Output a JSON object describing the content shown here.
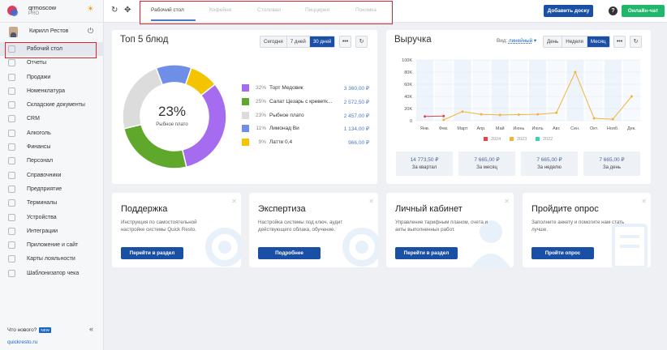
{
  "brand": {
    "name": "qrmoscow",
    "tier": "PRO"
  },
  "user": {
    "name": "Кирилл Рестов"
  },
  "sidebar": {
    "items": [
      {
        "label": "Рабочий стол",
        "icon": "dashboard-icon"
      },
      {
        "label": "Отчеты",
        "icon": "reports-icon"
      },
      {
        "label": "Продажи",
        "icon": "sales-icon"
      },
      {
        "label": "Номенклатура",
        "icon": "nomenclature-icon"
      },
      {
        "label": "Складские документы",
        "icon": "warehouse-icon"
      },
      {
        "label": "CRM",
        "icon": "crm-icon"
      },
      {
        "label": "Алкоголь",
        "icon": "alcohol-icon"
      },
      {
        "label": "Финансы",
        "icon": "finance-icon"
      },
      {
        "label": "Персонал",
        "icon": "staff-icon"
      },
      {
        "label": "Справочники",
        "icon": "directory-icon"
      },
      {
        "label": "Предприятие",
        "icon": "enterprise-icon"
      },
      {
        "label": "Терминалы",
        "icon": "terminal-icon"
      },
      {
        "label": "Устройства",
        "icon": "device-icon"
      },
      {
        "label": "Интеграции",
        "icon": "integration-icon"
      },
      {
        "label": "Приложение и сайт",
        "icon": "app-icon"
      },
      {
        "label": "Карты лояльности",
        "icon": "loyalty-card-icon"
      },
      {
        "label": "Шаблонизатор чека",
        "icon": "receipt-icon"
      }
    ],
    "whats_new": "Что нового?",
    "new_badge": "NEW",
    "link": "quickresto.ru"
  },
  "topbar": {
    "tabs": [
      "Рабочий стол",
      "Кофейня",
      "Столовая",
      "Пиццерия",
      "Покомка"
    ],
    "add_desk": "Добавить доску",
    "help": "?",
    "chat": "Онлайн-чат"
  },
  "top5": {
    "title": "Топ 5 блюд",
    "periods": [
      "Сегодня",
      "7 дней",
      "30 дней"
    ],
    "active_period": "30 дней",
    "center_pct": "23%",
    "center_label": "Рыбное плато",
    "items": [
      {
        "pct": "32%",
        "name": "Торт Медовик",
        "value": "3 360,00 ₽",
        "color": "#a66cf0",
        "share": 32
      },
      {
        "pct": "25%",
        "name": "Салат Цезарь с креветк...",
        "value": "2 572,50 ₽",
        "color": "#5fa82c",
        "share": 25
      },
      {
        "pct": "23%",
        "name": "Рыбное плато",
        "value": "2 457,00 ₽",
        "color": "#dcdcdc",
        "share": 23
      },
      {
        "pct": "11%",
        "name": "Лимонад Ви",
        "value": "1 134,00 ₽",
        "color": "#6e8ee8",
        "share": 11
      },
      {
        "pct": "9%",
        "name": "Латте 0,4",
        "value": "966,00 ₽",
        "color": "#f5c400",
        "share": 9
      }
    ]
  },
  "revenue": {
    "title": "Выручка",
    "view_label": "Вид:",
    "view_value": "линейный",
    "periods": [
      "День",
      "Неделя",
      "Месяц"
    ],
    "active_period": "Месяц",
    "stats": [
      {
        "value": "14 773,50 ₽",
        "label": "За квартал"
      },
      {
        "value": "7 665,00 ₽",
        "label": "За месяц"
      },
      {
        "value": "7 665,00 ₽",
        "label": "За неделю"
      },
      {
        "value": "7 665,00 ₽",
        "label": "За день"
      }
    ]
  },
  "chart_data": {
    "type": "line",
    "title": "Выручка",
    "x": [
      "Янв.",
      "Фев.",
      "Март",
      "Апр.",
      "Май",
      "Июнь",
      "Июль",
      "Авг.",
      "Сен.",
      "Окт.",
      "Нояб.",
      "Дек."
    ],
    "y_ticks": [
      "0",
      "20K",
      "40K",
      "60K",
      "80K",
      "100K"
    ],
    "ylim": [
      0,
      100000
    ],
    "series": [
      {
        "name": "2024",
        "color": "#e0454b",
        "values": [
          7000,
          7700,
          null,
          null,
          null,
          null,
          null,
          null,
          null,
          null,
          null,
          null
        ]
      },
      {
        "name": "2023",
        "color": "#f3b43c",
        "values": [
          null,
          1500,
          15000,
          10500,
          9500,
          10000,
          10500,
          13000,
          80000,
          4000,
          2500,
          40000
        ]
      },
      {
        "name": "2022",
        "color": "#3fcfb4",
        "values": [
          null,
          null,
          null,
          null,
          null,
          null,
          null,
          null,
          null,
          null,
          null,
          null
        ]
      }
    ],
    "legend_position": "bottom",
    "grid": true
  },
  "info_cards": [
    {
      "title": "Поддержка",
      "desc": "Инструкция по самостоятельной настройке системы Quick Resto.",
      "button": "Перейти в раздел"
    },
    {
      "title": "Экспертиза",
      "desc": "Настройка системы под ключ, аудит действующего облака, обучение.",
      "button": "Подробнее"
    },
    {
      "title": "Личный кабинет",
      "desc": "Управление тарифным планом, счета и акты выполненных работ.",
      "button": "Перейти в раздел"
    },
    {
      "title": "Пройдите опрос",
      "desc": "Заполните анкету и помогите нам стать лучше.",
      "button": "Пройти опрос"
    }
  ]
}
